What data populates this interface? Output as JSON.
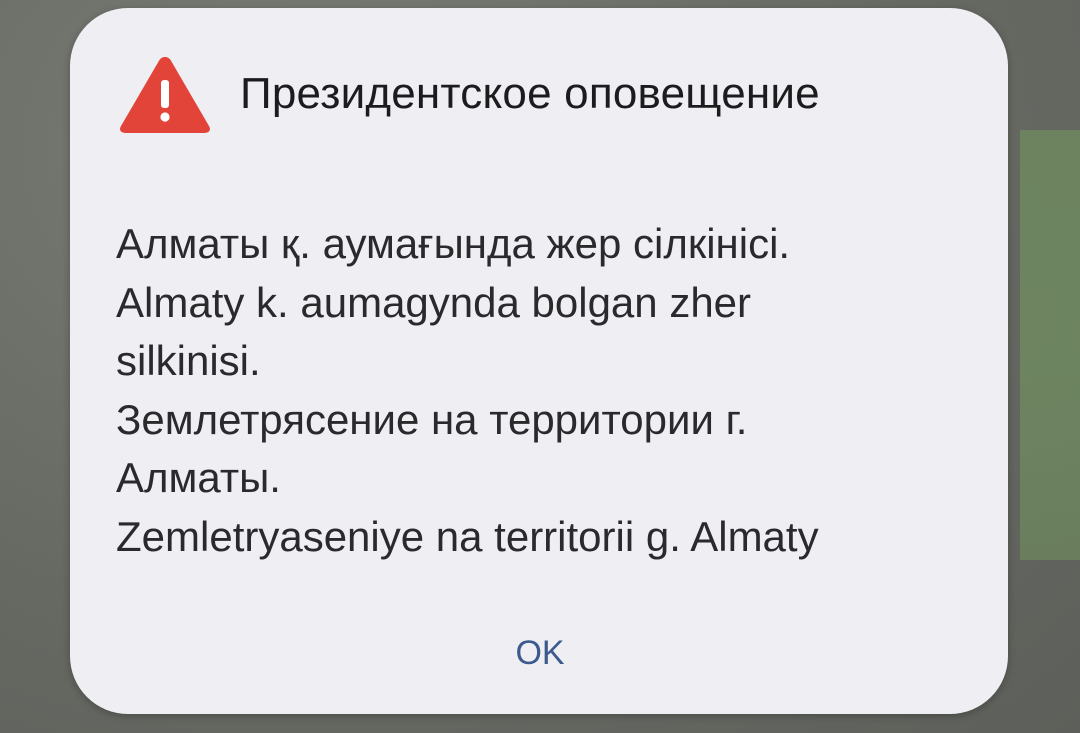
{
  "alert": {
    "title": "Президентское оповещение",
    "icon": "warning-triangle-icon",
    "icon_color": "#e2443a",
    "message_lines": [
      "Алматы қ. аумағында жер сілкінісі.",
      "Almaty k. aumagynda bolgan zher",
      "silkinisi.",
      "Землетрясение на территории г.",
      "Алматы.",
      "Zemletryaseniye na territorii g. Almaty"
    ],
    "ok_label": "OK",
    "ok_color": "#3d5a8e"
  }
}
